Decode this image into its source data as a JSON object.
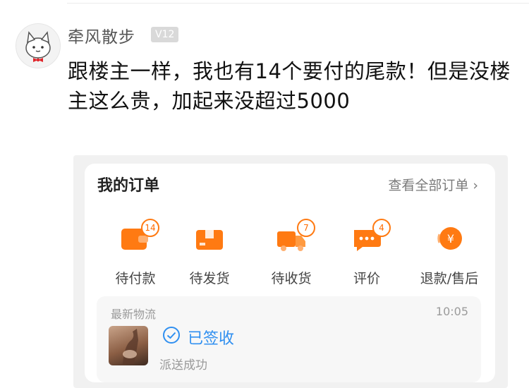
{
  "comment": {
    "username": "牵风散步",
    "level": "V12",
    "text": "跟楼主一样，我也有14个要付的尾款！但是没楼主这么贵，加起来没超过5000"
  },
  "screenshot": {
    "section_title": "我的订单",
    "view_all": "查看全部订单",
    "view_all_icon": "chevron-right-icon",
    "accent_color": "#ff7a12",
    "orders": [
      {
        "label": "待付款",
        "badge": "14",
        "icon": "wallet-icon"
      },
      {
        "label": "待发货",
        "badge": "",
        "icon": "package-icon"
      },
      {
        "label": "待收货",
        "badge": "7",
        "icon": "truck-icon"
      },
      {
        "label": "评价",
        "badge": "4",
        "icon": "chat-icon"
      },
      {
        "label": "退款/售后",
        "badge": "",
        "icon": "refund-icon"
      }
    ],
    "logistics": {
      "header": "最新物流",
      "time": "10:05",
      "status": "已签收",
      "status_color": "#2f8ff0",
      "detail": "派送成功"
    }
  }
}
